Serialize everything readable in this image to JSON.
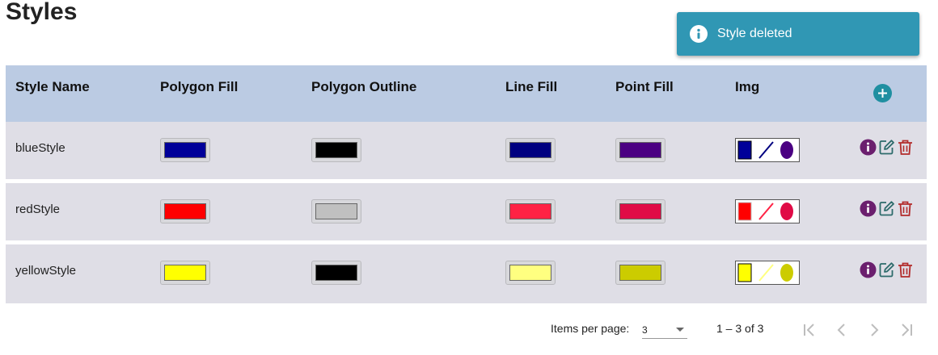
{
  "page": {
    "title": "Styles"
  },
  "toast": {
    "message": "Style deleted",
    "icon": "info-circle-icon",
    "color": "#3097b4"
  },
  "table": {
    "columns": [
      "Style Name",
      "Polygon Fill",
      "Polygon Outline",
      "Line Fill",
      "Point Fill",
      "Img"
    ],
    "add_icon": "plus-circle-icon",
    "rows": [
      {
        "name": "blueStyle",
        "polygon_fill": "#000099",
        "polygon_outline": "#000000",
        "line_fill": "#000080",
        "point_fill": "#4b0082"
      },
      {
        "name": "redStyle",
        "polygon_fill": "#ff0000",
        "polygon_outline": "#c0c0c0",
        "line_fill": "#ff2244",
        "point_fill": "#e00b46"
      },
      {
        "name": "yellowStyle",
        "polygon_fill": "#ffff00",
        "polygon_outline": "#000000",
        "line_fill": "#ffff80",
        "point_fill": "#cccc00"
      }
    ],
    "row_actions": [
      "info-icon",
      "edit-icon",
      "trash-icon"
    ]
  },
  "paginator": {
    "items_per_page_label": "Items per page:",
    "items_per_page_value": "3",
    "range_label": "1 – 3 of 3"
  },
  "colors": {
    "header_bg": "#bbcbe3",
    "row_bg": "#dfdee6",
    "info_purple": "#6b1f6e",
    "edit_teal": "#2d6b6b",
    "delete_red": "#b22b2b"
  }
}
